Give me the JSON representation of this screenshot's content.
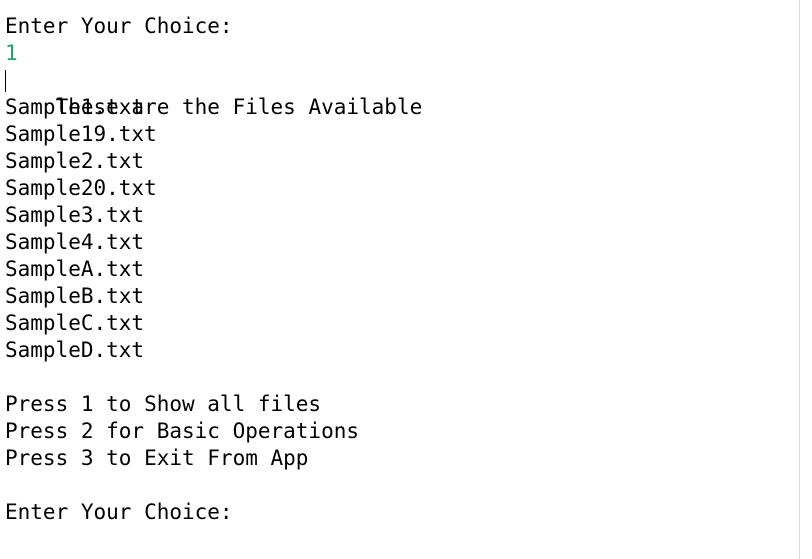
{
  "console": {
    "prompt_1": "Enter Your Choice:",
    "user_input_1": "1",
    "files_header": "These are the Files Available",
    "files": [
      "Sample1.txt",
      "Sample19.txt",
      "Sample2.txt",
      "Sample20.txt",
      "Sample3.txt",
      "Sample4.txt",
      "SampleA.txt",
      "SampleB.txt",
      "SampleC.txt",
      "SampleD.txt"
    ],
    "menu": [
      "Press 1 to Show all files",
      "Press 2 for Basic Operations",
      "Press 3 to Exit From App"
    ],
    "prompt_2": "Enter Your Choice:"
  },
  "colors": {
    "input_text": "#1fa868",
    "output_text": "#000000",
    "background": "#ffffff"
  }
}
